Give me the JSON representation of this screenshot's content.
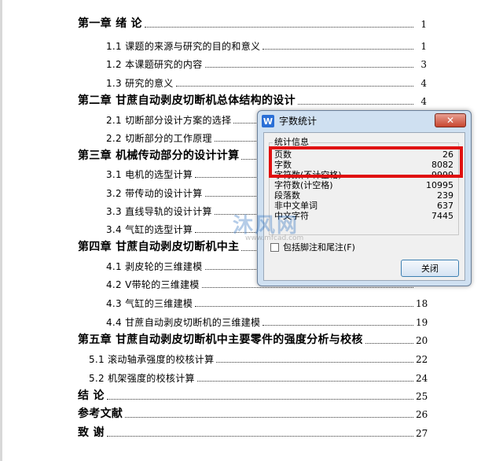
{
  "toc": [
    {
      "label": "第一章  绪    论",
      "page": "1",
      "chapter": true
    },
    {
      "label": "1.1 课题的来源与研究的目的和意义",
      "page": "1",
      "chapter": false
    },
    {
      "label": "1.2 本课题研究的内容",
      "page": "3",
      "chapter": false
    },
    {
      "label": "1.3 研究的意义",
      "page": "4",
      "chapter": false
    },
    {
      "label": "第二章  甘蔗自动剥皮切断机总体结构的设计",
      "page": "4",
      "chapter": true
    },
    {
      "label": "2.1 切断部分设计方案的选择",
      "page": "",
      "chapter": false
    },
    {
      "label": "2.2 切断部分的工作原理",
      "page": "",
      "chapter": false
    },
    {
      "label": "第三章  机械传动部分的设计计算",
      "page": "",
      "chapter": true
    },
    {
      "label": "3.1 电机的选型计算",
      "page": "",
      "chapter": false
    },
    {
      "label": "3.2 带传动的设计计算",
      "page": "",
      "chapter": false
    },
    {
      "label": "3.3 直线导轨的设计计算",
      "page": "",
      "chapter": false
    },
    {
      "label": "3.4 气缸的选型计算",
      "page": "",
      "chapter": false
    },
    {
      "label": "第四章  甘蔗自动剥皮切断机中主",
      "page": "",
      "chapter": true
    },
    {
      "label": "4.1 剥皮轮的三维建模",
      "page": "",
      "chapter": false
    },
    {
      "label": "4.2 V带轮的三维建模",
      "page": "",
      "chapter": false
    },
    {
      "label": "4.3 气缸的三维建模",
      "page": "18",
      "chapter": false
    },
    {
      "label": "4.4 甘蔗自动剥皮切断机的三维建模",
      "page": "19",
      "chapter": false
    },
    {
      "label": "第五章  甘蔗自动剥皮切断机中主要零件的强度分析与校核",
      "page": "20",
      "chapter": true
    },
    {
      "label": "5.1 滚动轴承强度的校核计算",
      "page": "22",
      "chapter": false
    },
    {
      "label": "5.2 机架强度的校核计算",
      "page": "24",
      "chapter": false
    },
    {
      "label": "结    论",
      "page": "25",
      "chapter": true
    },
    {
      "label": "参考文献",
      "page": "26",
      "chapter": true
    },
    {
      "label": "致    谢",
      "page": "27",
      "chapter": true
    }
  ],
  "dialog": {
    "title": "字数统计",
    "app_icon": "W",
    "group_label": "统计信息",
    "stats": [
      {
        "label": "页数",
        "value": "26"
      },
      {
        "label": "字数",
        "value": "8082"
      },
      {
        "label": "字符数(不计空格)",
        "value": "9999"
      },
      {
        "label": "字符数(计空格)",
        "value": "10995"
      },
      {
        "label": "段落数",
        "value": "239"
      },
      {
        "label": "非中文单词",
        "value": "637"
      },
      {
        "label": "中文字符",
        "value": "7445"
      }
    ],
    "footnote_label": "包括脚注和尾注(F)",
    "close_button": "关闭",
    "close_x": "✕"
  },
  "watermark": {
    "text": "沐风网",
    "url": "www.mfcad.com"
  }
}
